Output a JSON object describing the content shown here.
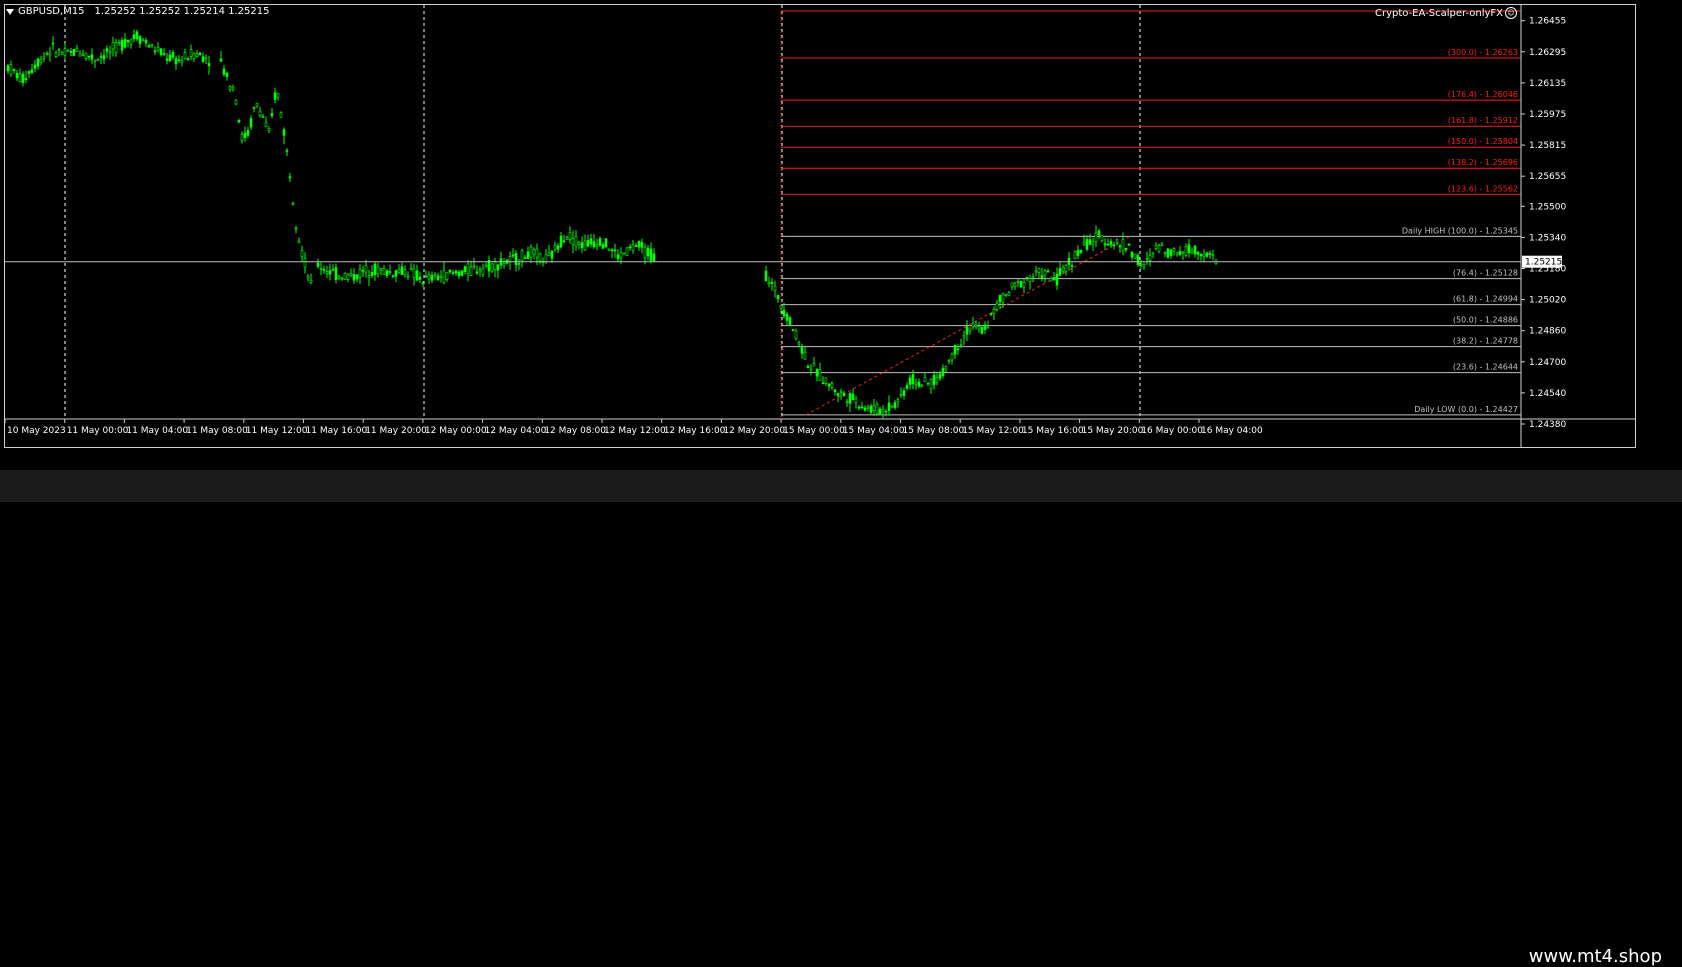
{
  "symbol": {
    "title": "GBPUSD,M15",
    "ohlc": "1.25252 1.25252 1.25214 1.25215"
  },
  "ea_label": "Crypto-EA-Scalper-onlyFX",
  "watermark": "www.mt4.shop",
  "colors": {
    "candle": "#00ff00",
    "extension": "#ff1a1a",
    "retracement": "#c0c0c0",
    "bid": "#c0c0c0",
    "grid": "#ffffff",
    "trend": "#ff1a1a"
  },
  "price_axis": {
    "ticks": [
      "1.26455",
      "1.26295",
      "1.26135",
      "1.25975",
      "1.25815",
      "1.25655",
      "1.25500",
      "1.25340",
      "1.25180",
      "1.25020",
      "1.24860",
      "1.24700",
      "1.24540",
      "1.24380"
    ],
    "current_price": "1.25215"
  },
  "time_axis": {
    "labels": [
      "10 May 2023",
      "11 May 00:00",
      "11 May 04:00",
      "11 May 08:00",
      "11 May 12:00",
      "11 May 16:00",
      "11 May 20:00",
      "12 May 00:00",
      "12 May 04:00",
      "12 May 08:00",
      "12 May 12:00",
      "12 May 16:00",
      "12 May 20:00",
      "15 May 00:00",
      "15 May 04:00",
      "15 May 08:00",
      "15 May 12:00",
      "15 May 16:00",
      "15 May 20:00",
      "16 May 00:00",
      "16 May 04:00"
    ]
  },
  "fibo_levels": [
    {
      "label": "(300.0) - 1.26263",
      "kind": "extension",
      "price": 1.26263
    },
    {
      "label": "(176.4) - 1.26046",
      "kind": "extension",
      "price": 1.26046
    },
    {
      "label": "(161.8) - 1.25912",
      "kind": "extension",
      "price": 1.25912
    },
    {
      "label": "(150.0) - 1.25804",
      "kind": "extension",
      "price": 1.25804
    },
    {
      "label": "(138.2) - 1.25696",
      "kind": "extension",
      "price": 1.25696
    },
    {
      "label": "(123.6) - 1.25562",
      "kind": "extension",
      "price": 1.25562
    },
    {
      "label": "Daily HIGH (100.0) - 1.25345",
      "kind": "retracement",
      "price": 1.25345
    },
    {
      "label": "(76.4) - 1.25128",
      "kind": "retracement",
      "price": 1.25128
    },
    {
      "label": "(61.8) - 1.24994",
      "kind": "retracement",
      "price": 1.24994
    },
    {
      "label": "(50.0) - 1.24886",
      "kind": "retracement",
      "price": 1.24886
    },
    {
      "label": "(38.2) - 1.24778",
      "kind": "retracement",
      "price": 1.24778
    },
    {
      "label": "(23.6) - 1.24644",
      "kind": "retracement",
      "price": 1.24644
    },
    {
      "label": "Daily LOW (0.0) - 1.24427",
      "kind": "retracement",
      "price": 1.24427
    }
  ],
  "price_series": [
    [
      1.2622,
      1.2615,
      1.2624,
      1.2631,
      1.2628,
      1.263,
      1.2626,
      1.2629,
      1.2634,
      1.2638,
      1.2632,
      1.2627,
      1.2625,
      1.2629,
      1.2626
    ],
    [
      1.2624,
      1.2615,
      1.261,
      1.2585,
      1.2588,
      1.2603,
      1.2597,
      1.2586,
      1.2612,
      1.2591,
      1.2566,
      1.2538,
      1.2522,
      1.2509
    ],
    [
      1.252,
      1.2515,
      1.2514,
      1.2518,
      1.2516,
      1.2517,
      1.2512,
      1.2514,
      1.2516,
      1.2518,
      1.252,
      1.2522,
      1.2526,
      1.2522,
      1.2536,
      1.253,
      1.2533,
      1.2524,
      1.253,
      1.2524
    ],
    [
      1.2515,
      1.2501,
      1.2485,
      1.2468,
      1.2461,
      1.2454,
      1.2451,
      1.2446,
      1.2445,
      1.2449,
      1.2461,
      1.2458,
      1.2462,
      1.2476,
      1.2488,
      1.2486,
      1.25,
      1.2508,
      1.2513,
      1.2516,
      1.2512,
      1.2522,
      1.253,
      1.2534,
      1.2531,
      1.2529,
      1.2518,
      1.253,
      1.2526,
      1.2528,
      1.2527,
      1.2522
    ]
  ]
}
